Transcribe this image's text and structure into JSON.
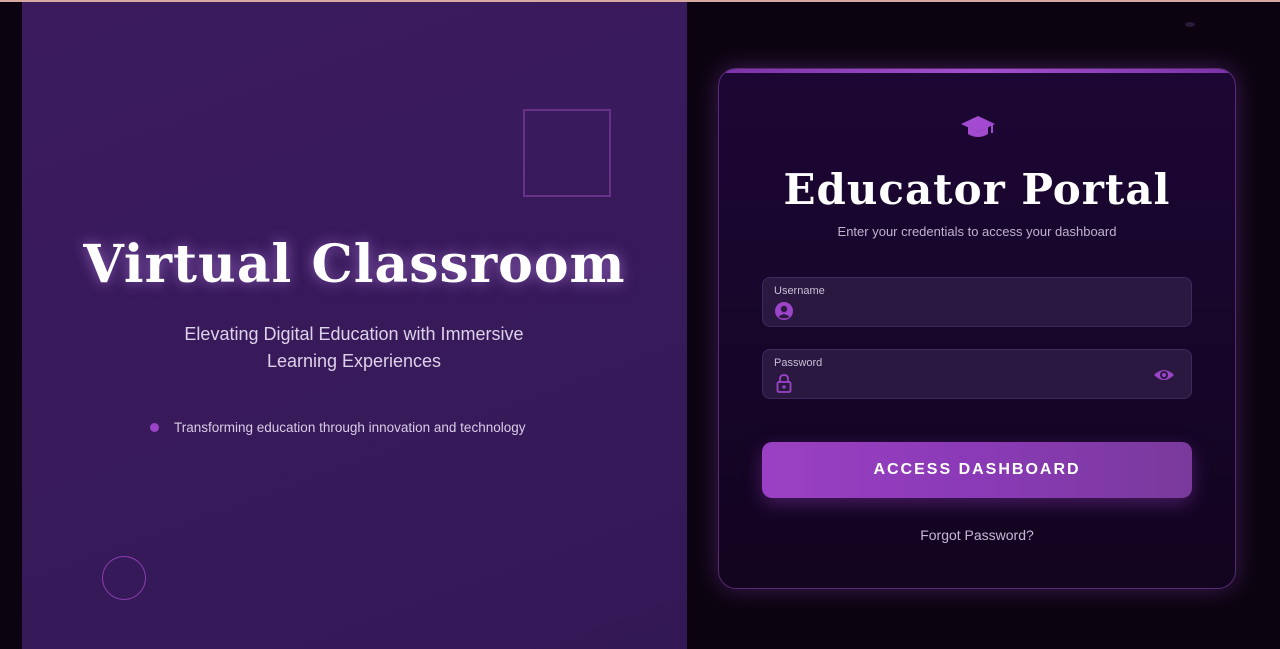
{
  "hero": {
    "title": "Virtual Classroom",
    "subtitle": "Elevating Digital Education with Immersive Learning Experiences",
    "bullet": "Transforming education through innovation and technology"
  },
  "login": {
    "icon": "graduation-cap-icon",
    "title": "Educator Portal",
    "subtitle": "Enter your credentials to access your dashboard",
    "username": {
      "label": "Username",
      "value": "",
      "icon": "user-icon"
    },
    "password": {
      "label": "Password",
      "value": "",
      "icon": "lock-icon",
      "toggle_icon": "eye-icon"
    },
    "submit_label": "ACCESS DASHBOARD",
    "forgot_label": "Forgot Password?"
  },
  "colors": {
    "accent": "#9b44c8",
    "left_panel": "#381a5b",
    "card_bg": "#1a0630",
    "page_bg": "#0b0410"
  }
}
